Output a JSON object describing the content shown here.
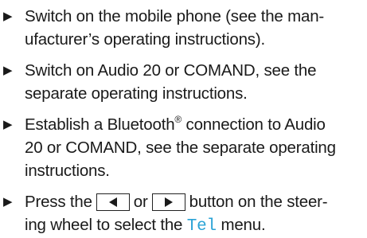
{
  "steps": [
    {
      "lines": [
        "Switch on the mobile phone (see the man-",
        "ufacturer’s operating instructions)."
      ]
    },
    {
      "lines": [
        "Switch on Audio 20 or COMAND, see the",
        "separate operating instructions."
      ]
    },
    {
      "line1_pre": "Establish a Bluetooth",
      "line1_sup": "®",
      "line1_post": " connection to Audio",
      "lines_rest": [
        "20 or COMAND, see the separate operating",
        "instructions."
      ]
    },
    {
      "line1_pre": "Press the",
      "line1_mid": "or",
      "line1_post": "button on the steer-",
      "line2_pre": "ing wheel to select the ",
      "line2_menu": "Tel",
      "line2_post": " menu.",
      "key_left_icon": "left-triangle-icon",
      "key_right_icon": "right-triangle-icon"
    }
  ],
  "bullet_icon": "right-triangle-bullet-icon",
  "colors": {
    "text": "#1a1a1a",
    "menu_highlight": "#2aa3d6"
  }
}
